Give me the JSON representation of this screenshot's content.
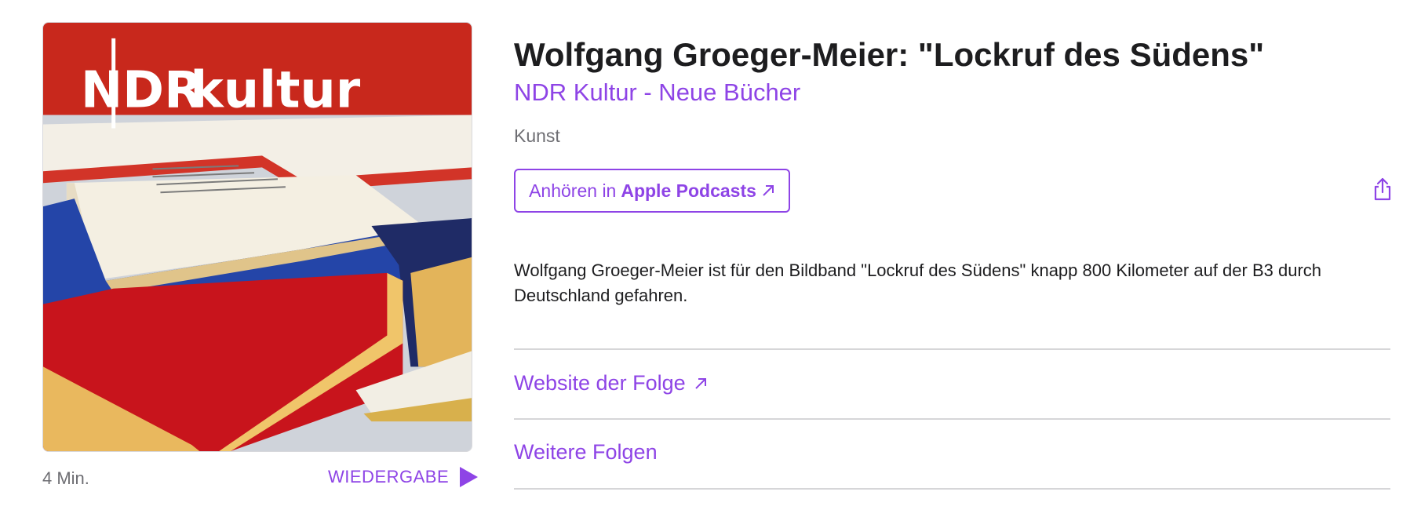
{
  "episode": {
    "title": "Wolfgang Groeger-Meier: \"Lockruf des Südens\"",
    "show": "NDR Kultur - Neue Bücher",
    "category": "Kunst",
    "description": "Wolfgang Groeger-Meier ist für den Bildband \"Lockruf des Südens\" knapp 800 Kilometer auf der B3 durch Deutschland gefahren.",
    "duration": "4 Min."
  },
  "artwork": {
    "logo_text_left": "NDR",
    "logo_text_right": "kultur",
    "banner_color": "#c8281c"
  },
  "actions": {
    "play_label": "WIEDERGABE",
    "listen_prefix": "Anhören in",
    "listen_app": "Apple Podcasts",
    "share_icon": "share-icon"
  },
  "links": {
    "website": "Website der Folge",
    "more_episodes": "Weitere Folgen"
  },
  "colors": {
    "accent": "#8e44e6",
    "text": "#1d1d1f",
    "secondary": "#6e6e73"
  }
}
